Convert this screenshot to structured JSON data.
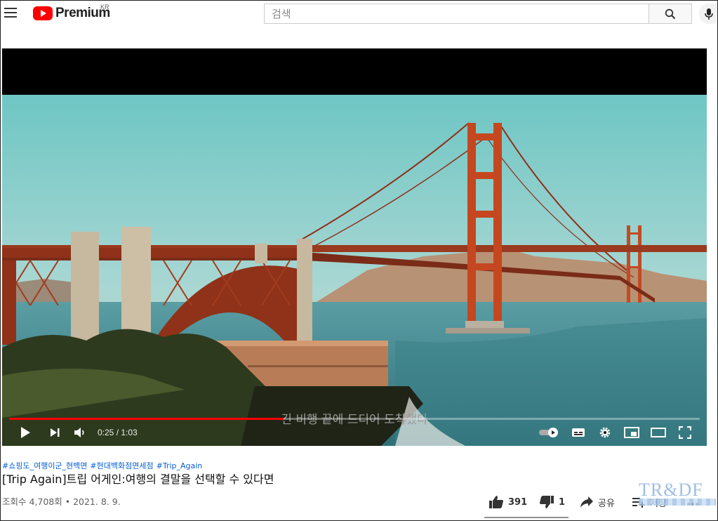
{
  "header": {
    "logo_text": "Premium",
    "logo_region": "KR",
    "search_placeholder": "검색"
  },
  "player": {
    "subtitle": "긴 비행 끝에 드디어 도착했다",
    "time_display": "0:25 / 1:03",
    "progress_fraction": 0.397
  },
  "video": {
    "hashtags": [
      "#쇼핑도_여행이군_현백면",
      "#현대백화점면세점",
      "#Trip_Again"
    ],
    "title": "[Trip Again]트립 어게인:여행의 결말을 선택할 수 있다면",
    "meta": "조회수 4,708회 • 2021. 8. 9."
  },
  "actions": {
    "like_count": "391",
    "dislike_count": "1",
    "share_label": "공유",
    "save_label": "저장"
  },
  "watermark": "TR&DF",
  "colors": {
    "brand_red": "#ff0000",
    "hashtag_blue": "#065fd4"
  }
}
